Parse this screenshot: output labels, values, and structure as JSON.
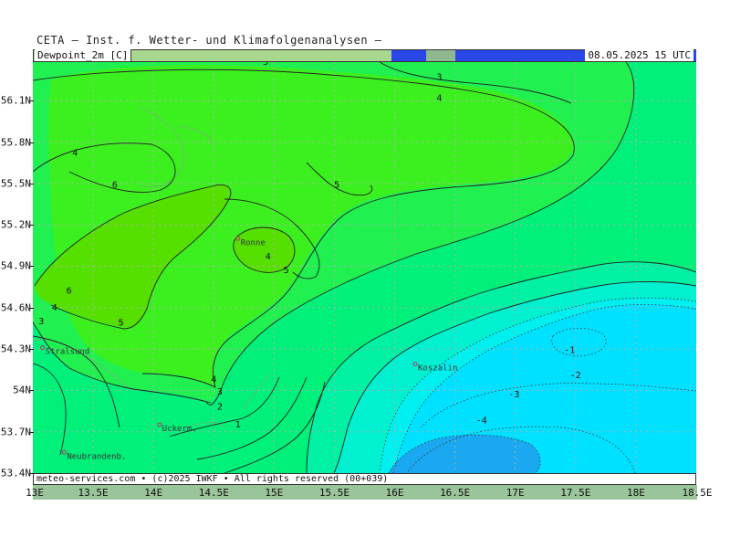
{
  "header": {
    "title": "CETA — Inst. f. Wetter- und Klimafolgenanalysen —",
    "field": "Dewpoint_2m [C]",
    "valid": "08.05.2025 15 UTC"
  },
  "footer": {
    "copyright": "meteo-services.com • (c)2025 IWKF • All rights reserved (00+039)"
  },
  "axes": {
    "x_ticks": [
      "13E",
      "13.5E",
      "14E",
      "14.5E",
      "15E",
      "15.5E",
      "16E",
      "16.5E",
      "17E",
      "17.5E",
      "18E",
      "18.5E"
    ],
    "y_ticks": [
      "56.1N",
      "55.8N",
      "55.5N",
      "55.2N",
      "54.9N",
      "54.6N",
      "54.3N",
      "54N",
      "53.7N",
      "53.4N"
    ]
  },
  "colors": {
    "c_ge6": "#55e000",
    "c_5_6": "#3cf020",
    "c_4_5": "#20f050",
    "c_3_4": "#00f07a",
    "c_2_3": "#00f0a4",
    "c_1_2": "#00f0d0",
    "c_0_1": "#00f0f0",
    "c_lt0": "#00e0ff",
    "c_lt4": "#1aa8f0"
  },
  "cities": [
    {
      "name": "Ronne",
      "lon": 14.7,
      "lat": 55.1
    },
    {
      "name": "Stralsund",
      "lon": 13.08,
      "lat": 54.31
    },
    {
      "name": "Koszalin",
      "lon": 16.17,
      "lat": 54.19
    },
    {
      "name": "Uckerm.",
      "lon": 14.05,
      "lat": 53.75
    },
    {
      "name": "Neubrandenb.",
      "lon": 13.26,
      "lat": 53.55
    }
  ],
  "contour_labels": [
    {
      "text": "5",
      "lon": 14.93,
      "lat": 56.36
    },
    {
      "text": "3",
      "lon": 16.37,
      "lat": 56.25
    },
    {
      "text": "4",
      "lon": 16.37,
      "lat": 56.1
    },
    {
      "text": "4",
      "lon": 13.35,
      "lat": 55.7
    },
    {
      "text": "6",
      "lon": 13.68,
      "lat": 55.47
    },
    {
      "text": "5",
      "lon": 15.52,
      "lat": 55.47
    },
    {
      "text": "4",
      "lon": 14.95,
      "lat": 54.95
    },
    {
      "text": "5",
      "lon": 15.1,
      "lat": 54.85
    },
    {
      "text": "6",
      "lon": 13.3,
      "lat": 54.7
    },
    {
      "text": "4",
      "lon": 13.18,
      "lat": 54.58
    },
    {
      "text": "3",
      "lon": 13.07,
      "lat": 54.48
    },
    {
      "text": "5",
      "lon": 13.73,
      "lat": 54.47
    },
    {
      "text": "4",
      "lon": 14.5,
      "lat": 54.06
    },
    {
      "text": "3",
      "lon": 14.55,
      "lat": 53.97
    },
    {
      "text": "2",
      "lon": 14.55,
      "lat": 53.86
    },
    {
      "text": "1",
      "lon": 14.7,
      "lat": 53.73
    },
    {
      "text": "-1",
      "lon": 17.45,
      "lat": 54.27
    },
    {
      "text": "-2",
      "lon": 17.5,
      "lat": 54.09
    },
    {
      "text": "-3",
      "lon": 16.99,
      "lat": 53.95
    },
    {
      "text": "-4",
      "lon": 16.72,
      "lat": 53.76
    }
  ]
}
